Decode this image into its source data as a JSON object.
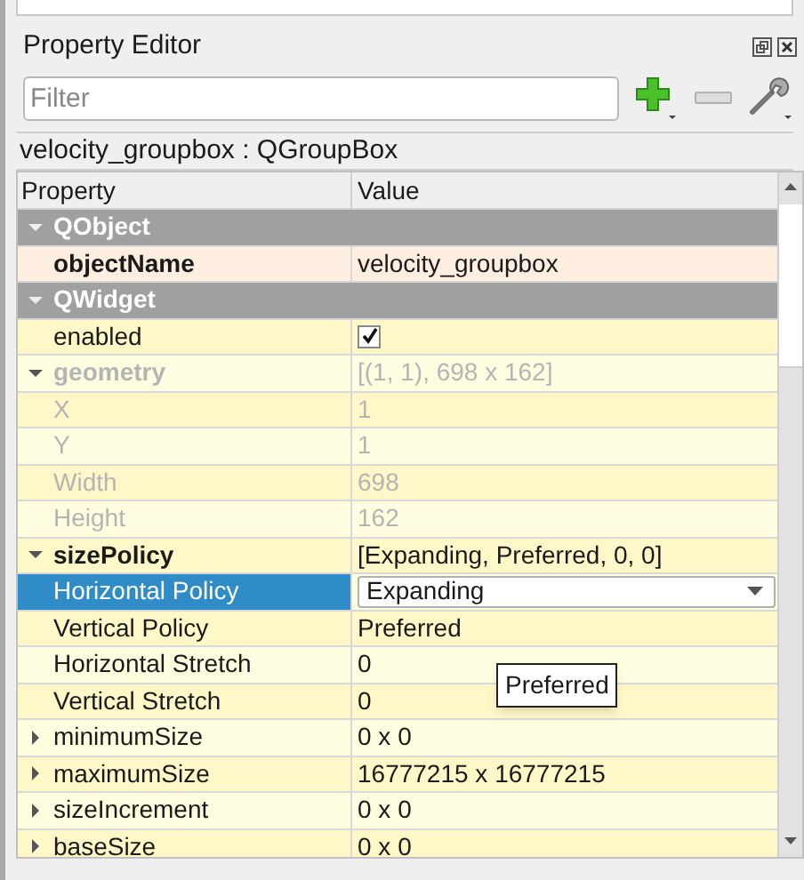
{
  "panel": {
    "title": "Property Editor"
  },
  "filter": {
    "placeholder": "Filter"
  },
  "object_label": "velocity_groupbox : QGroupBox",
  "table": {
    "columns": [
      "Property",
      "Value"
    ],
    "rows": [
      {
        "kind": "section",
        "name": "QObject",
        "expanded": true,
        "children": [
          {
            "kind": "text",
            "name": "objectName",
            "value": "velocity_groupbox",
            "changed": true,
            "disabled": false,
            "selected": false
          }
        ]
      },
      {
        "kind": "section",
        "name": "QWidget",
        "expanded": true,
        "children": [
          {
            "kind": "checkbox",
            "name": "enabled",
            "checked": true,
            "changed": false,
            "disabled": false,
            "selected": false
          },
          {
            "kind": "text",
            "name": "geometry",
            "value": "[(1, 1), 698 x 162]",
            "changed": true,
            "disabled": true,
            "selected": false,
            "expanded": true,
            "children": [
              {
                "kind": "text",
                "name": "X",
                "value": "1",
                "changed": false,
                "disabled": true,
                "selected": false
              },
              {
                "kind": "text",
                "name": "Y",
                "value": "1",
                "changed": false,
                "disabled": true,
                "selected": false
              },
              {
                "kind": "text",
                "name": "Width",
                "value": "698",
                "changed": false,
                "disabled": true,
                "selected": false
              },
              {
                "kind": "text",
                "name": "Height",
                "value": "162",
                "changed": false,
                "disabled": true,
                "selected": false
              }
            ]
          },
          {
            "kind": "text",
            "name": "sizePolicy",
            "value": "[Expanding, Preferred, 0, 0]",
            "changed": true,
            "disabled": false,
            "selected": false,
            "expanded": true,
            "children": [
              {
                "kind": "combo",
                "name": "Horizontal Policy",
                "value": "Expanding",
                "changed": false,
                "disabled": false,
                "selected": true
              },
              {
                "kind": "text",
                "name": "Vertical Policy",
                "value": "Preferred",
                "changed": false,
                "disabled": false,
                "selected": false
              },
              {
                "kind": "text",
                "name": "Horizontal Stretch",
                "value": "0",
                "changed": false,
                "disabled": false,
                "selected": false
              },
              {
                "kind": "text",
                "name": "Vertical Stretch",
                "value": "0",
                "changed": false,
                "disabled": false,
                "selected": false
              }
            ]
          },
          {
            "kind": "text",
            "name": "minimumSize",
            "value": "0 x 0",
            "changed": false,
            "disabled": false,
            "selected": false,
            "expanded": false
          },
          {
            "kind": "text",
            "name": "maximumSize",
            "value": "16777215 x 16777215",
            "changed": false,
            "disabled": false,
            "selected": false,
            "expanded": false
          },
          {
            "kind": "text",
            "name": "sizeIncrement",
            "value": "0 x 0",
            "changed": false,
            "disabled": false,
            "selected": false,
            "expanded": false
          },
          {
            "kind": "text",
            "name": "baseSize",
            "value": "0 x 0",
            "changed": false,
            "disabled": false,
            "selected": false,
            "expanded": false
          }
        ]
      }
    ]
  },
  "tooltip": "Preferred"
}
